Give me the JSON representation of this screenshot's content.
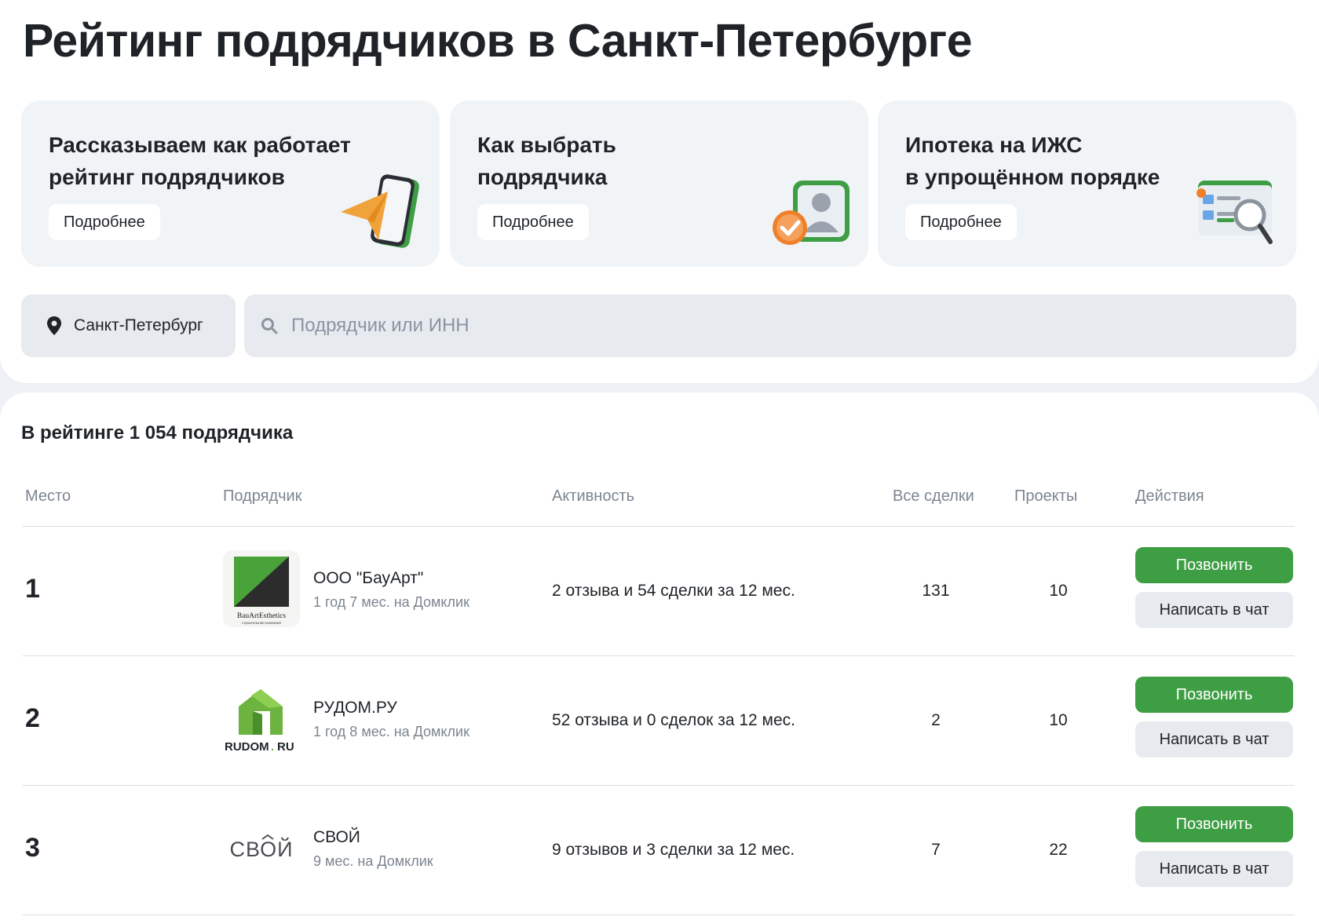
{
  "page": {
    "title": "Рейтинг подрядчиков в Санкт-Петербурге"
  },
  "promo_cards": [
    {
      "title": "Рассказываем как работает\nрейтинг подрядчиков",
      "button": "Подробнее",
      "icon": "phone-paper-plane-icon"
    },
    {
      "title": "Как выбрать\nподрядчика",
      "button": "Подробнее",
      "icon": "profile-check-icon"
    },
    {
      "title": "Ипотека на ИЖС\nв упрощённом порядке",
      "button": "Подробнее",
      "icon": "browser-magnifier-icon"
    }
  ],
  "filters": {
    "city": "Санкт-Петербург",
    "search_placeholder": "Подрядчик или ИНН"
  },
  "rating": {
    "count_text": "В рейтинге 1 054 подрядчика",
    "columns": {
      "place": "Место",
      "contractor": "Подрядчик",
      "activity": "Активность",
      "deals": "Все сделки",
      "projects": "Проекты",
      "actions": "Действия"
    },
    "rows": [
      {
        "place": "1",
        "name": "ООО \"БауАрт\"",
        "age": "1 год 7 мес. на Домклик",
        "activity": "2 отзыва и 54 сделки за 12 мес.",
        "deals": "131",
        "projects": "10",
        "logo_text": "BauArtEsthetics",
        "logo_subtext": "строительная компания"
      },
      {
        "place": "2",
        "name": "РУДОМ.РУ",
        "age": "1 год 8 мес. на Домклик",
        "activity": "52 отзыва и 0 сделок за 12 мес.",
        "deals": "2",
        "projects": "10",
        "logo_text_a": "RUDOM",
        "logo_text_dot": ".",
        "logo_text_b": "RU"
      },
      {
        "place": "3",
        "name": "СВОЙ",
        "age": "9 мес. на Домклик",
        "activity": "9 отзывов и 3 сделки за 12 мес.",
        "deals": "7",
        "projects": "22",
        "logo_text": "СВОЙ"
      }
    ],
    "call_label": "Позвонить",
    "chat_label": "Написать в чат"
  },
  "colors": {
    "accent_green": "#3e9e44",
    "card_bg": "#f1f4f7",
    "input_bg": "#e7ebf0",
    "page_bg": "#eef1f5"
  }
}
